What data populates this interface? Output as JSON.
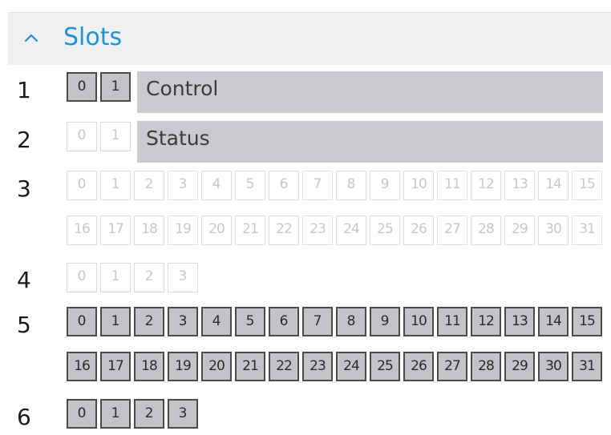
{
  "section": {
    "title": "Slots",
    "chevron_icon": "chevron-up-icon",
    "accent_color": "#1f93d6"
  },
  "slots": [
    {
      "number": "1",
      "name": "Control",
      "bit_count": 2,
      "active": true
    },
    {
      "number": "2",
      "name": "Status",
      "bit_count": 2,
      "active": false
    },
    {
      "number": "3",
      "name": "",
      "bit_count": 32,
      "active": false
    },
    {
      "number": "4",
      "name": "",
      "bit_count": 4,
      "active": false
    },
    {
      "number": "5",
      "name": "",
      "bit_count": 32,
      "active": true
    },
    {
      "number": "6",
      "name": "",
      "bit_count": 4,
      "active": true
    }
  ],
  "colors": {
    "active_fill": "#c3c3c7",
    "active_border": "#4b4b4b",
    "inactive_border": "#dcdcdc",
    "name_bar": "#c9cacd"
  }
}
